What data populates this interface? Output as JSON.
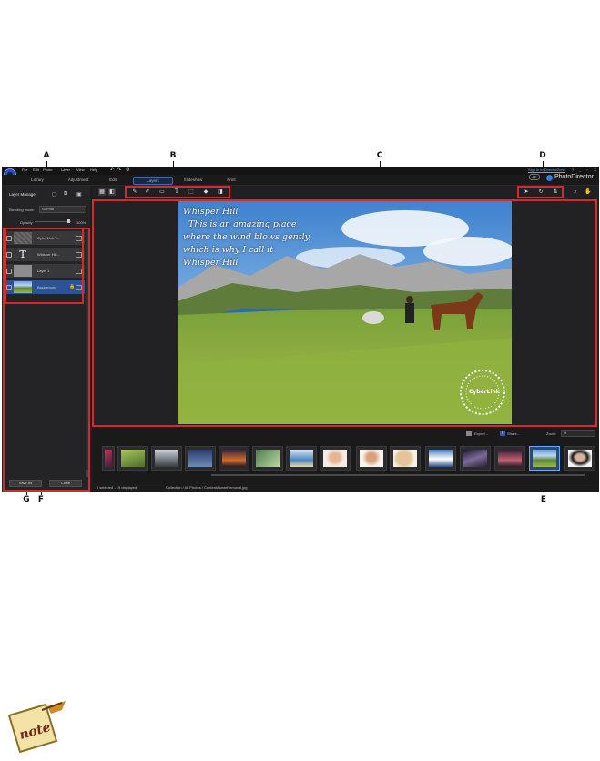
{
  "callouts": {
    "a": "A",
    "b": "B",
    "c": "C",
    "d": "D",
    "e": "E",
    "f": "F",
    "g": "G"
  },
  "app": {
    "menu": [
      "File",
      "Edit",
      "Photo",
      "Layer",
      "View",
      "Help"
    ],
    "sign_in": "Sign in to DirectorZone",
    "help": "?",
    "brand": "PhotoDirector",
    "badge": "AR",
    "tabs": [
      {
        "label": "Library"
      },
      {
        "label": "Adjustment"
      },
      {
        "label": "Edit"
      },
      {
        "label": "Layers",
        "active": true
      },
      {
        "label": "Slideshow"
      },
      {
        "label": "Print"
      }
    ]
  },
  "left_panel": {
    "title": "Layer Manager",
    "blending_label": "Blending mode:",
    "blending_value": "Normal",
    "opacity_label": "Opacity:",
    "opacity_value": "100%",
    "layers": [
      {
        "name": "CyberLink T..."
      },
      {
        "name": "Whisper Hill..."
      },
      {
        "name": "Layer 1"
      },
      {
        "name": "Background"
      }
    ],
    "save_button": "Save As",
    "close_button": "Close"
  },
  "photo": {
    "lines": [
      "Whisper Hill",
      "This is an amazing place",
      "where the wind blows gently,",
      "which is why I call it",
      "Whisper Hill"
    ],
    "watermark": "CyberLink"
  },
  "filmstrip": {
    "export": "Export...",
    "share": "Share...",
    "zoom_label": "Zoom:",
    "zoom_value": "fit"
  },
  "status": {
    "count": "1 selected - 19 displayed",
    "path": "Collection / All Photos / ContentAwareRemoval.jpg"
  }
}
